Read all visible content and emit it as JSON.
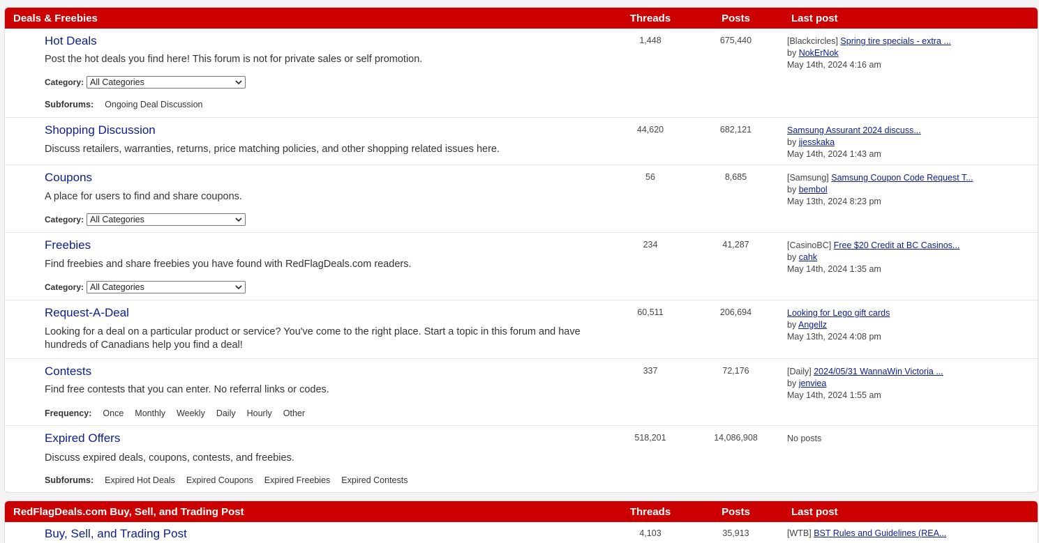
{
  "sections": [
    {
      "title": "Deals & Freebies",
      "col_threads": "Threads",
      "col_posts": "Posts",
      "col_last": "Last post",
      "forums": [
        {
          "title": "Hot Deals",
          "desc": "Post the hot deals you find here! This forum is not for private sales or self promotion.",
          "threads": "1,448",
          "posts": "675,440",
          "last_tag": "[Blackcircles]",
          "last_title": "Spring tire specials - extra ...",
          "by": "by",
          "last_user": "NokErNok",
          "last_date": "May 14th, 2024 4:16 am",
          "category_label": "Category:",
          "category_value": "All Categories",
          "subforums_label": "Subforums:",
          "subforums": [
            "Ongoing Deal Discussion"
          ]
        },
        {
          "title": "Shopping Discussion",
          "desc": "Discuss retailers, warranties, returns, price matching policies, and other shopping related issues here.",
          "threads": "44,620",
          "posts": "682,121",
          "last_tag": "",
          "last_title": "Samsung Assurant 2024 discuss...",
          "by": "by",
          "last_user": "jjesskaka",
          "last_date": "May 14th, 2024 1:43 am"
        },
        {
          "title": "Coupons",
          "desc": "A place for users to find and share coupons.",
          "threads": "56",
          "posts": "8,685",
          "last_tag": "[Samsung]",
          "last_title": "Samsung Coupon Code Request T...",
          "by": "by",
          "last_user": "bembol",
          "last_date": "May 13th, 2024 8:23 pm",
          "category_label": "Category:",
          "category_value": "All Categories"
        },
        {
          "title": "Freebies",
          "desc": "Find freebies and share freebies you have found with RedFlagDeals.com readers.",
          "threads": "234",
          "posts": "41,287",
          "last_tag": "[CasinoBC]",
          "last_title": "Free $20 Credit at BC Casinos...",
          "by": "by",
          "last_user": "cahk",
          "last_date": "May 14th, 2024 1:35 am",
          "category_label": "Category:",
          "category_value": "All Categories"
        },
        {
          "title": "Request-A-Deal",
          "desc": "Looking for a deal on a particular product or service? You've come to the right place. Start a topic in this forum and have hundreds of Canadians help you find a deal!",
          "threads": "60,511",
          "posts": "206,694",
          "last_tag": "",
          "last_title": "Looking for Lego gift cards",
          "by": "by",
          "last_user": "Angellz",
          "last_date": "May 13th, 2024 4:08 pm"
        },
        {
          "title": "Contests",
          "desc": "Find free contests that you can enter. No referral links or codes.",
          "threads": "337",
          "posts": "72,176",
          "last_tag": "[Daily]",
          "last_title": "2024/05/31 WannaWin Victoria ...",
          "by": "by",
          "last_user": "jenviea",
          "last_date": "May 14th, 2024 1:55 am",
          "frequency_label": "Frequency:",
          "frequency": [
            "Once",
            "Monthly",
            "Weekly",
            "Daily",
            "Hourly",
            "Other"
          ]
        },
        {
          "title": "Expired Offers",
          "desc": "Discuss expired deals, coupons, contests, and freebies.",
          "threads": "518,201",
          "posts": "14,086,908",
          "no_posts": "No posts",
          "subforums_label": "Subforums:",
          "subforums": [
            "Expired Hot Deals",
            "Expired Coupons",
            "Expired Freebies",
            "Expired Contests"
          ]
        }
      ]
    },
    {
      "title": "RedFlagDeals.com Buy, Sell, and Trading Post",
      "col_threads": "Threads",
      "col_posts": "Posts",
      "col_last": "Last post",
      "forums": [
        {
          "title": "Buy, Sell, and Trading Post",
          "threads": "4,103",
          "posts": "35,913",
          "last_tag": "[WTB]",
          "last_title": "BST Rules and Guidelines (REA..."
        }
      ]
    }
  ],
  "colors": {
    "header_red": "#cc0000",
    "link_blue": "#0b1d8f"
  }
}
